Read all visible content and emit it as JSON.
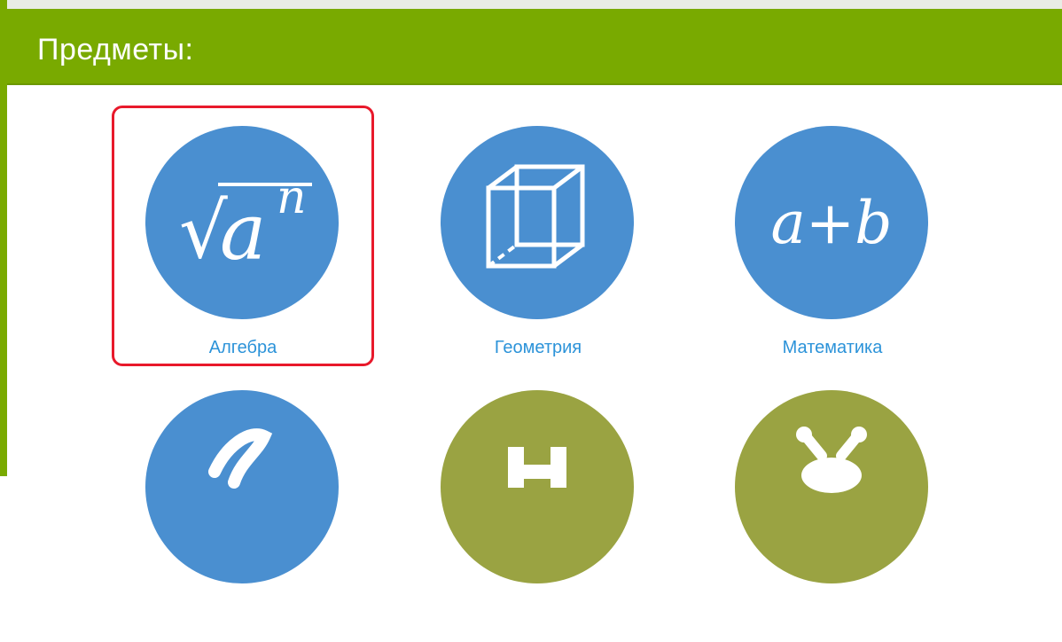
{
  "header": {
    "title": "Предметы:"
  },
  "subjects": [
    {
      "label": "Алгебра",
      "icon": "sqrt-a-power-n-icon",
      "color": "#4a8fd0"
    },
    {
      "label": "Геометрия",
      "icon": "cube-icon",
      "color": "#4a8fd0"
    },
    {
      "label": "Математика",
      "icon": "a-plus-b-icon",
      "color": "#4a8fd0"
    }
  ],
  "subjects_row2": [
    {
      "icon": "curve-icon",
      "color": "#4a8fd0"
    },
    {
      "icon": "grid-icon",
      "color": "#9aa342"
    },
    {
      "icon": "bug-icon",
      "color": "#9aa342"
    }
  ],
  "icon_text": {
    "algebra_sqrt": "√",
    "algebra_a": "a",
    "algebra_n": "n",
    "math": "a+b"
  }
}
